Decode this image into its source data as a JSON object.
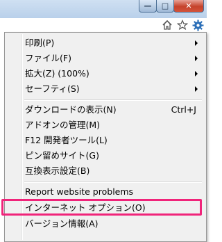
{
  "window": {
    "minimize_symbol": "—",
    "maximize_symbol": "□",
    "close_symbol": "✕"
  },
  "toolbar": {
    "icons": [
      "home-icon",
      "favorites-star-icon",
      "tools-gear-icon"
    ]
  },
  "menu": {
    "items": [
      {
        "label": "印刷(P)",
        "has_submenu": true
      },
      {
        "label": "ファイル(F)",
        "has_submenu": true
      },
      {
        "label": "拡大(Z) (100%)",
        "has_submenu": true
      },
      {
        "label": "セーフティ(S)",
        "has_submenu": true
      },
      {
        "label": "ダウンロードの表示(N)",
        "shortcut": "Ctrl+J"
      },
      {
        "label": "アドオンの管理(M)"
      },
      {
        "label": "F12 開発者ツール(L)"
      },
      {
        "label": "ピン留めサイト(G)"
      },
      {
        "label": "互換表示設定(B)"
      },
      {
        "label": "Report website problems"
      },
      {
        "label": "インターネット オプション(O)"
      },
      {
        "label": "バージョン情報(A)"
      }
    ]
  },
  "colors": {
    "highlight_border": "#f0247a",
    "menu_background": "#f0f0f0",
    "gear_icon": "#2b6fb8"
  }
}
